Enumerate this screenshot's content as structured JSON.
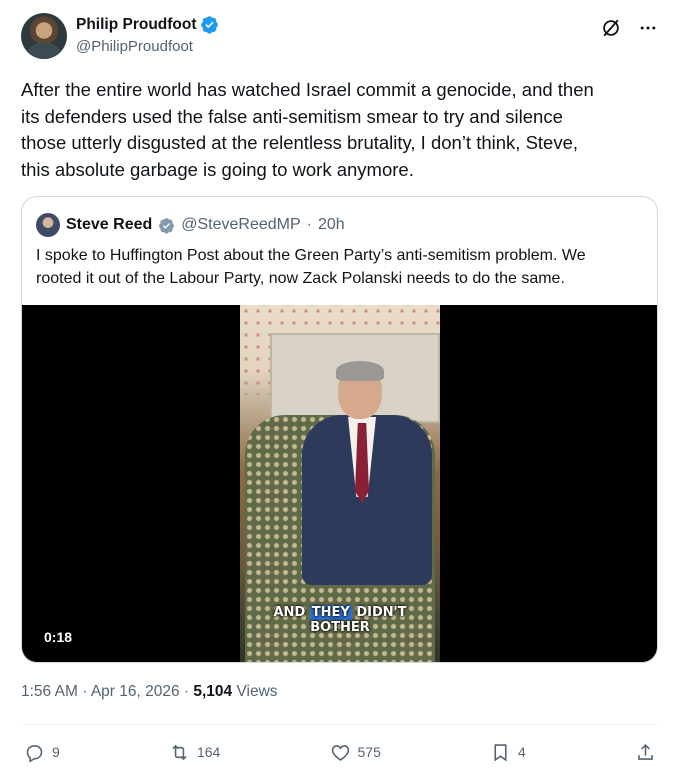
{
  "author": {
    "display_name": "Philip Proudfoot",
    "handle": "@PhilipProudfoot",
    "verified_icon": "verified-badge-icon",
    "verified_color": "#1d9bf0"
  },
  "header_icons": [
    "grok-icon",
    "more-options-icon"
  ],
  "tweet_text": "After the entire world has watched Israel commit a genocide, and then\nits defenders used the false anti-semitism smear to try and silence\nthose utterly disgusted at the relentless brutality, I don’t think, Steve,\nthis absolute garbage is going to work anymore.",
  "quoted": {
    "display_name": "Steve Reed",
    "handle": "@SteveReedMP",
    "separator": "·",
    "time": "20h",
    "badge_color": "#829aab",
    "text": "I spoke to Huffington Post about the Green Party’s anti-semitism problem. We\nrooted it out of the Labour Party, now Zack Polanski needs to do the same.",
    "video": {
      "duration": "0:18",
      "caption_pre": "AND ",
      "caption_highlight": "THEY",
      "caption_post": " DIDN'T",
      "caption_line2": "BOTHER"
    }
  },
  "meta": {
    "time": "1:56 AM",
    "separator": "·",
    "date": "Apr 16, 2026",
    "views_count": "5,104",
    "views_label": "Views"
  },
  "actions": {
    "replies": "9",
    "reposts": "164",
    "likes": "575",
    "bookmarks": "4"
  }
}
